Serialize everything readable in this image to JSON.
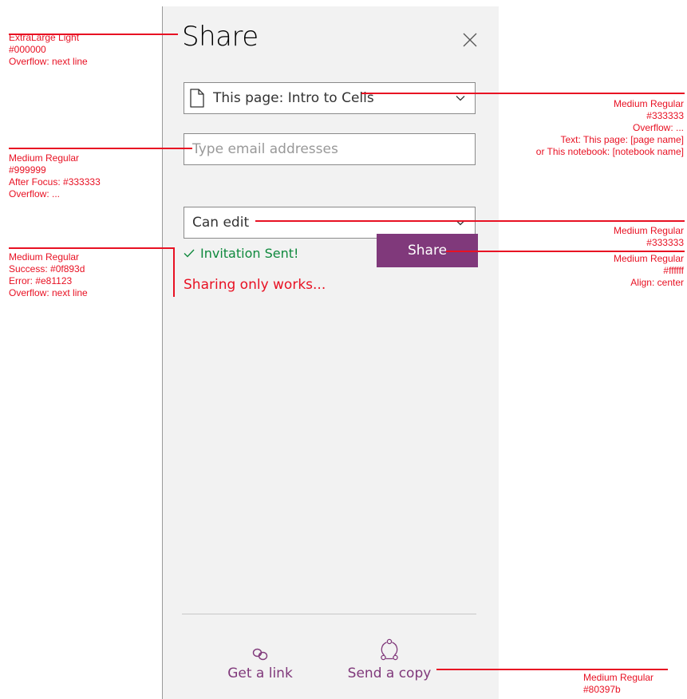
{
  "panel": {
    "title": "Share",
    "scope_select": {
      "value": "This page: Intro to Cells"
    },
    "email_field": {
      "placeholder": "Type email addresses"
    },
    "permission_select": {
      "value": "Can edit"
    },
    "status_success": "Invitation Sent!",
    "status_error": "Sharing only works...",
    "share_button": "Share",
    "footer": {
      "get_link_label": "Get a link",
      "send_copy_label": "Send a copy"
    }
  },
  "annotations": {
    "title_note": "ExtraLarge Light\n#000000\nOverflow: next line",
    "email_note": "Medium Regular\n#999999\nAfter Focus: #333333\nOverflow: ...",
    "status_note": "Medium Regular\nSuccess: #0f893d\nError: #e81123\nOverflow: next line",
    "scope_note": "Medium Regular\n#333333\nOverflow: ...\nText: This page: [page name]\nor This notebook: [notebook name]",
    "permission_note": "Medium Regular\n#333333",
    "share_note": "Medium Regular\n#ffffff\nAlign: center",
    "footer_note": "Medium Regular\n#80397b"
  },
  "colors": {
    "accent": "#80397b",
    "success": "#0f893d",
    "error": "#e81123",
    "text": "#333333",
    "placeholder": "#999999",
    "annotation": "#e81123"
  },
  "icons": {
    "close": "close-icon",
    "page": "page-icon",
    "chevron": "chevron-down-icon",
    "check": "check-icon",
    "link": "link-icon",
    "send": "share-icon"
  }
}
